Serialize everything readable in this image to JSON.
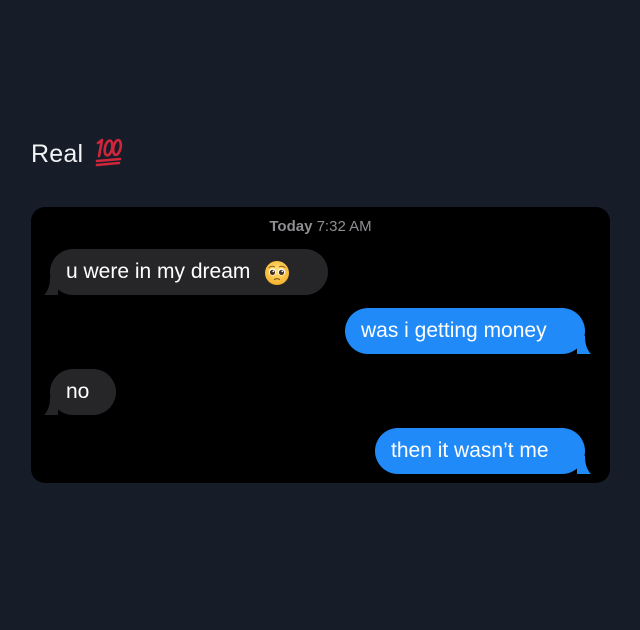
{
  "post": {
    "caption": "Real",
    "caption_emoji": "hundred-points-emoji"
  },
  "chat": {
    "timestamp_day": "Today",
    "timestamp_time": "7:32 AM",
    "messages": [
      {
        "direction": "incoming",
        "text": "u were in my dream",
        "emoji": "pleading-face-emoji"
      },
      {
        "direction": "outgoing",
        "text": "was i getting money"
      },
      {
        "direction": "incoming",
        "text": "no"
      },
      {
        "direction": "outgoing",
        "text": "then it wasn’t me"
      }
    ]
  },
  "colors": {
    "page_background": "#161d29",
    "chat_background": "#000000",
    "incoming_bubble": "#262628",
    "outgoing_bubble": "#1f8af8",
    "timestamp_text": "#8e8e93",
    "caption_emoji_red": "#d0253a"
  }
}
